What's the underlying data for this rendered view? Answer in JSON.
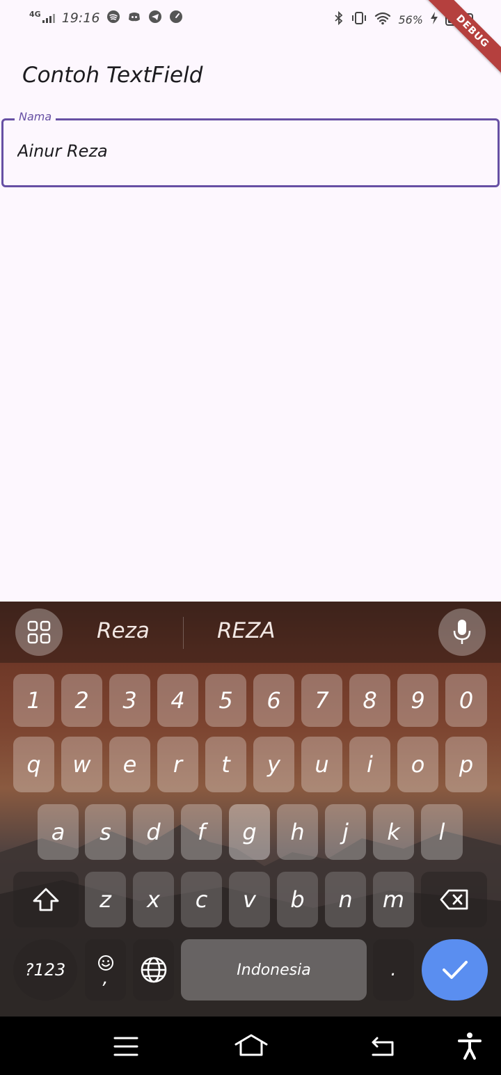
{
  "status_bar": {
    "network": "4G",
    "time": "19:16",
    "battery_percent": "56%",
    "battery_level": 0.56,
    "app_icons": [
      "spotify-icon",
      "discord-icon",
      "telegram-icon",
      "speedometer-icon"
    ],
    "right_icons": [
      "bluetooth-icon",
      "vibrate-icon",
      "wifi-icon",
      "charging-icon"
    ]
  },
  "debug_banner": "DEBUG",
  "app_bar": {
    "title": "Contoh TextField"
  },
  "text_field": {
    "label": "Nama",
    "value": "Ainur Reza"
  },
  "keyboard": {
    "suggestions": [
      "Reza",
      "REZA"
    ],
    "number_row": [
      "1",
      "2",
      "3",
      "4",
      "5",
      "6",
      "7",
      "8",
      "9",
      "0"
    ],
    "row1": [
      "q",
      "w",
      "e",
      "r",
      "t",
      "y",
      "u",
      "i",
      "o",
      "p"
    ],
    "row2": [
      "a",
      "s",
      "d",
      "f",
      "g",
      "h",
      "j",
      "k",
      "l"
    ],
    "row3": [
      "z",
      "x",
      "c",
      "v",
      "b",
      "n",
      "m"
    ],
    "symbols_label": "?123",
    "emoji_comma": ",",
    "space_label": "Indonesia",
    "period": "."
  },
  "colors": {
    "accent": "#6750a4",
    "background": "#fdf7fe",
    "enter_key": "#5a8ef0",
    "debug_ribbon": "#b5403e"
  }
}
